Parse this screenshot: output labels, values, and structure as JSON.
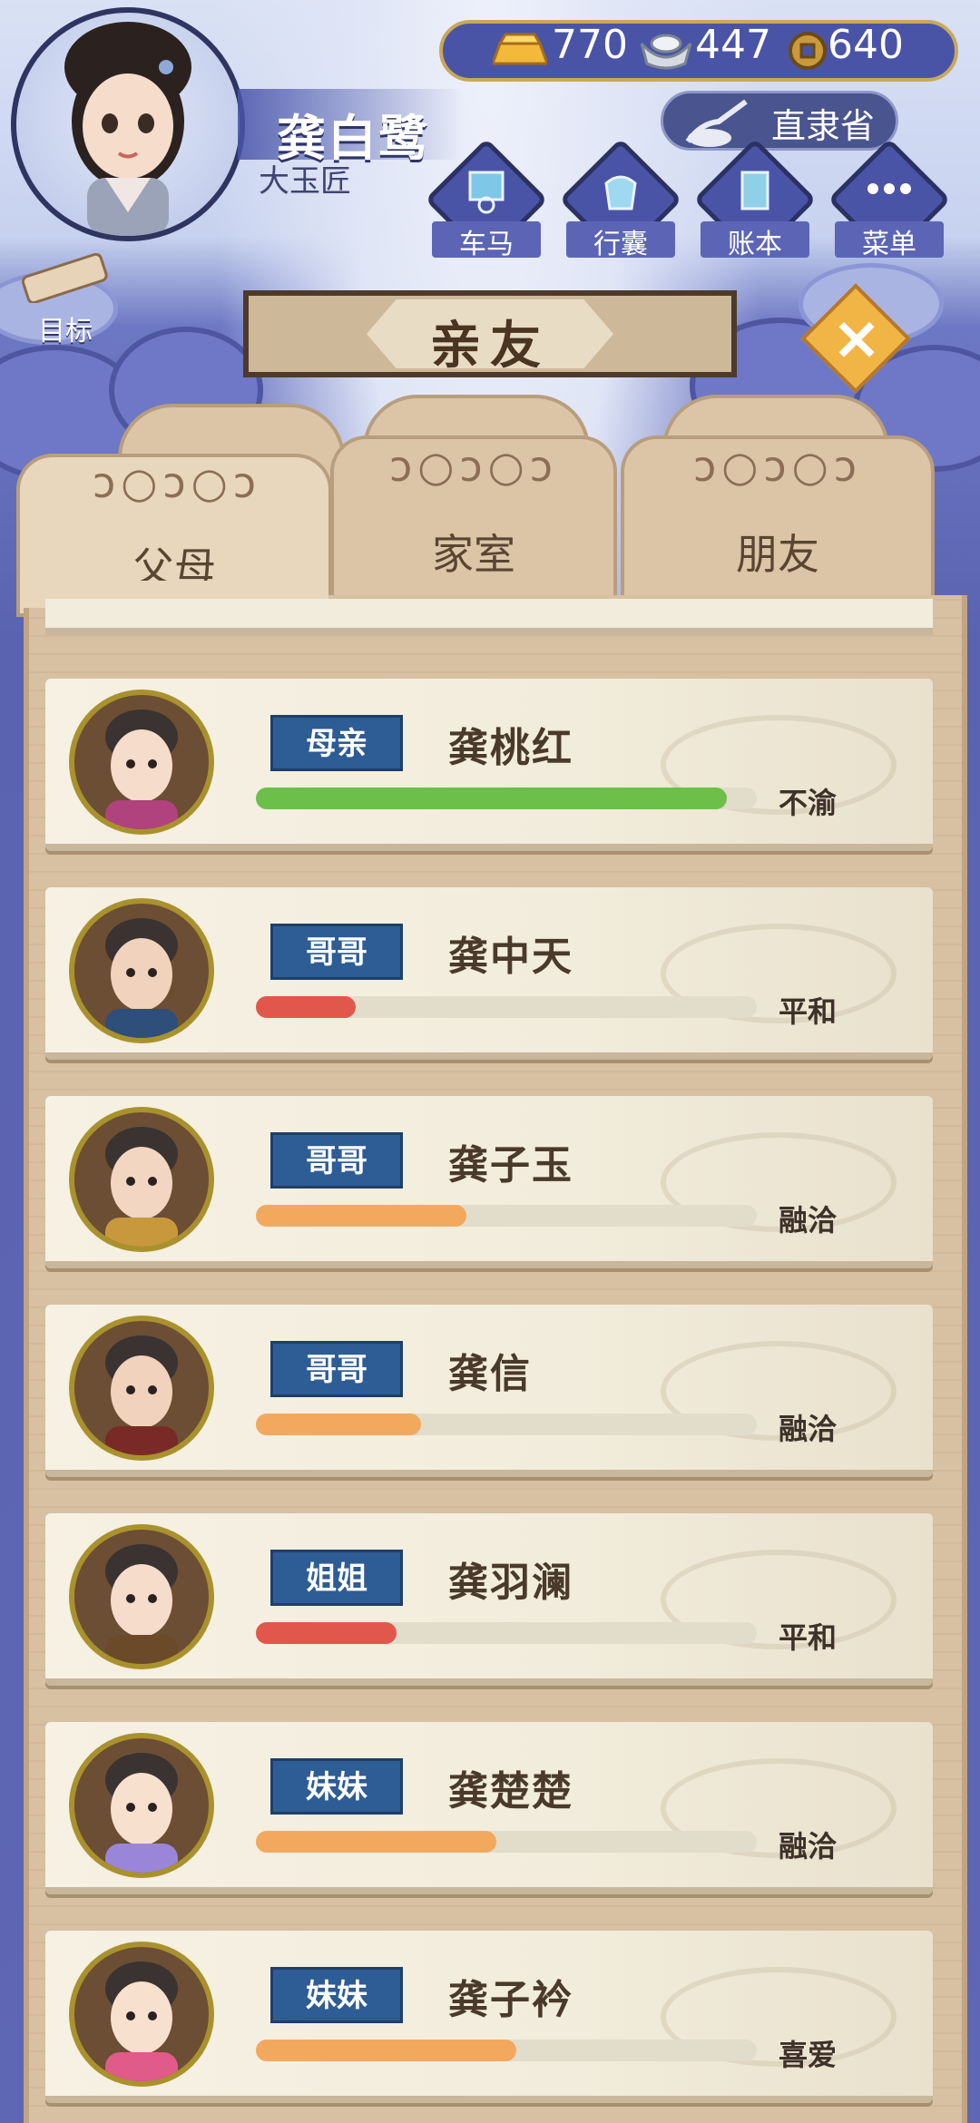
{
  "player": {
    "name": "龚白鹭",
    "title": "大玉匠"
  },
  "currency": {
    "gold": "770",
    "silver": "447",
    "coin": "640"
  },
  "location": "直隶省",
  "nav": [
    {
      "label": "车马",
      "icon": "carriage-icon"
    },
    {
      "label": "行囊",
      "icon": "bag-icon"
    },
    {
      "label": "账本",
      "icon": "ledger-icon"
    },
    {
      "label": "菜单",
      "icon": "menu-dots-icon"
    }
  ],
  "goal_label": "目标",
  "page_title": "亲友",
  "tabs": [
    {
      "label": "父母",
      "active": true
    },
    {
      "label": "家室",
      "active": false
    },
    {
      "label": "朋友",
      "active": false
    }
  ],
  "relatives": [
    {
      "role": "母亲",
      "name": "龚桃红",
      "mood": "不渝",
      "relation": 0.94,
      "bar_color": "#6cc04a"
    },
    {
      "role": "哥哥",
      "name": "龚中天",
      "mood": "平和",
      "relation": 0.2,
      "bar_color": "#e2574c"
    },
    {
      "role": "哥哥",
      "name": "龚子玉",
      "mood": "融洽",
      "relation": 0.42,
      "bar_color": "#f2a95e"
    },
    {
      "role": "哥哥",
      "name": "龚信",
      "mood": "融洽",
      "relation": 0.33,
      "bar_color": "#f2a95e"
    },
    {
      "role": "姐姐",
      "name": "龚羽澜",
      "mood": "平和",
      "relation": 0.28,
      "bar_color": "#e2574c"
    },
    {
      "role": "妹妹",
      "name": "龚楚楚",
      "mood": "融洽",
      "relation": 0.48,
      "bar_color": "#f2a95e"
    },
    {
      "role": "妹妹",
      "name": "龚子衿",
      "mood": "喜爱",
      "relation": 0.52,
      "bar_color": "#f2a95e"
    }
  ]
}
